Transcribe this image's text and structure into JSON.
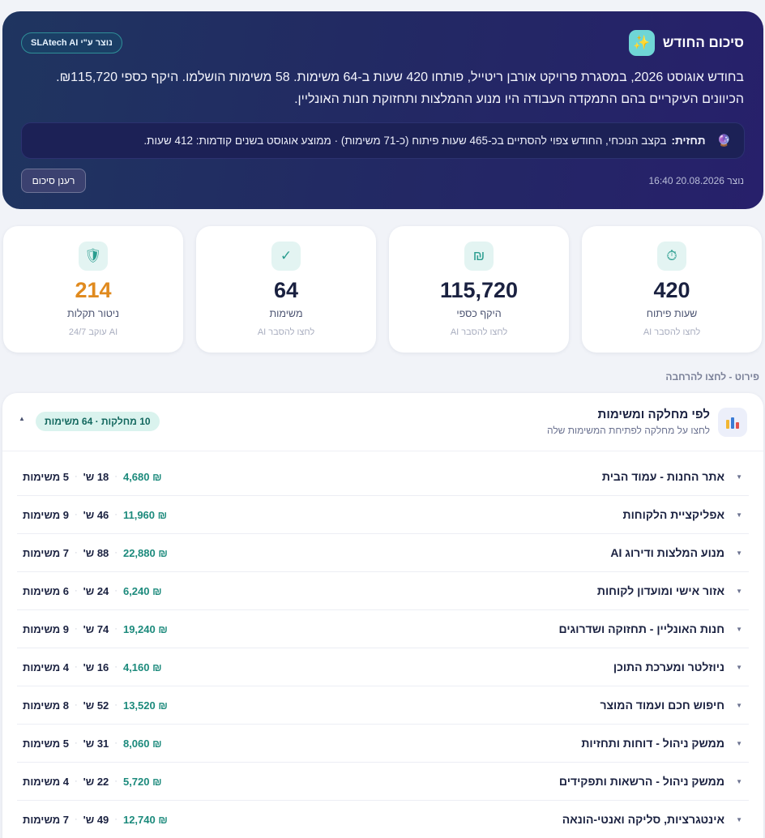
{
  "summary": {
    "title": "סיכום החודש",
    "badge": "נוצר ע\"י SLAtech AI",
    "text_line1": "בחודש אוגוסט 2026, במסגרת פרויקט אורבן ריטייל, פותחו 420 שעות ב-64 משימות. 58 משימות הושלמו. היקף כספי ₪115,720.",
    "text_line2": "הכיוונים העיקריים בהם התמקדה העבודה היו מנוע ההמלצות ותחזוקת חנות האונליין.",
    "forecast_label": "תחזית:",
    "forecast_text": "בקצב הנוכחי, החודש צפוי להסתיים בכ-465 שעות פיתוח (כ-71 משימות) · ממוצע אוגוסט בשנים קודמות: 412 שעות.",
    "generated_at": "נוצר 20.08.2026 16:40",
    "refresh_label": "רענן סיכום"
  },
  "kpis": [
    {
      "value": "420",
      "label": "שעות פיתוח",
      "sub": "לחצו להסבר AI",
      "icon": "stopwatch-icon",
      "glyph": "⏱"
    },
    {
      "value": "115,720",
      "label": "היקף כספי",
      "sub": "לחצו להסבר AI",
      "icon": "shekel-icon",
      "glyph": "₪"
    },
    {
      "value": "64",
      "label": "משימות",
      "sub": "לחצו להסבר AI",
      "icon": "checkmark-icon",
      "glyph": "✓"
    },
    {
      "value": "214",
      "label": "ניטור תקלות",
      "sub": "AI עוקב 24/7",
      "icon": "shield-icon",
      "glyph": "🛡"
    }
  ],
  "breakdown": {
    "caption": "פירוט - לחצו להרחבה",
    "title": "לפי מחלקה ומשימות",
    "subtitle": "לחצו על מחלקה לפתיחת המשימות שלה",
    "count_badge": "10 מחלקות · 64 משימות",
    "rows": [
      {
        "name": "אתר החנות - עמוד הבית",
        "money": "₪ 4,680",
        "hours": "18 ש'",
        "tasks": "5 משימות"
      },
      {
        "name": "אפליקציית הלקוחות",
        "money": "₪ 11,960",
        "hours": "46 ש'",
        "tasks": "9 משימות"
      },
      {
        "name": "מנוע המלצות ודירוג AI",
        "money": "₪ 22,880",
        "hours": "88 ש'",
        "tasks": "7 משימות"
      },
      {
        "name": "אזור אישי ומועדון לקוחות",
        "money": "₪ 6,240",
        "hours": "24 ש'",
        "tasks": "6 משימות"
      },
      {
        "name": "חנות האונליין - תחזוקה ושדרוגים",
        "money": "₪ 19,240",
        "hours": "74 ש'",
        "tasks": "9 משימות"
      },
      {
        "name": "ניוזלטר ומערכת התוכן",
        "money": "₪ 4,160",
        "hours": "16 ש'",
        "tasks": "4 משימות"
      },
      {
        "name": "חיפוש חכם ועמוד המוצר",
        "money": "₪ 13,520",
        "hours": "52 ש'",
        "tasks": "8 משימות"
      },
      {
        "name": "ממשק ניהול - דוחות ותחזיות",
        "money": "₪ 8,060",
        "hours": "31 ש'",
        "tasks": "5 משימות"
      },
      {
        "name": "ממשק ניהול - הרשאות ותפקידים",
        "money": "₪ 5,720",
        "hours": "22 ש'",
        "tasks": "4 משימות"
      },
      {
        "name": "אינטגרציות, סליקה ואנטי-הונאה",
        "money": "₪ 12,740",
        "hours": "49 ש'",
        "tasks": "7 משימות"
      }
    ]
  },
  "colors": {
    "accent": "#1c8a7c",
    "warning": "#e08a1e",
    "summary_bg": "#222a63"
  }
}
